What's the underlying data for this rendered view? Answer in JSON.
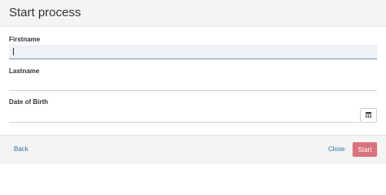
{
  "dialog": {
    "title": "Start process"
  },
  "form": {
    "firstname": {
      "label": "Firstname",
      "value": ""
    },
    "lastname": {
      "label": "Lastname",
      "value": ""
    },
    "date_of_birth": {
      "label": "Date of Birth",
      "value": "",
      "button_icon": "calendar-icon"
    }
  },
  "footer": {
    "back_label": "Back",
    "close_label": "Close",
    "start_label": "Start"
  },
  "colors": {
    "link": "#2f6f9f",
    "primary_button": "#d9747e",
    "focused_field": "#eef1f5"
  }
}
